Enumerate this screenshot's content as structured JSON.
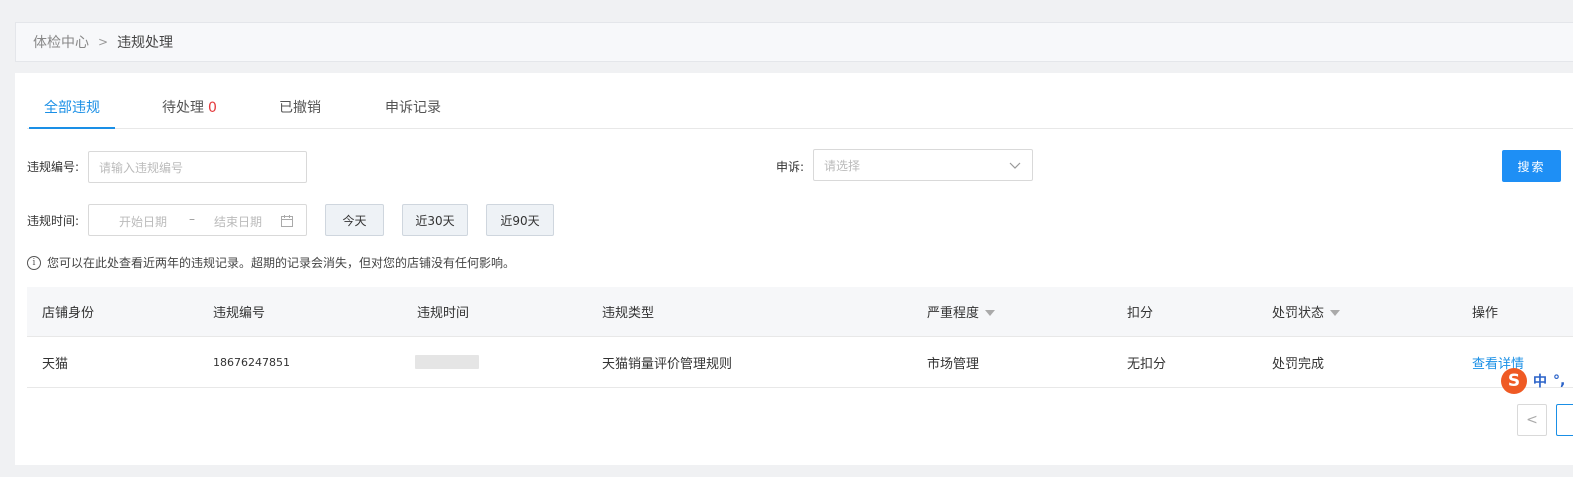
{
  "breadcrumb": {
    "root": "体检中心",
    "separator": ">",
    "current": "违规处理"
  },
  "tabs": [
    {
      "label": "全部违规",
      "active": true
    },
    {
      "label": "待处理",
      "count": "0"
    },
    {
      "label": "已撤销"
    },
    {
      "label": "申诉记录"
    }
  ],
  "filters": {
    "violation_no_label": "违规编号:",
    "violation_no_placeholder": "请输入违规编号",
    "appeal_label": "申诉:",
    "appeal_placeholder": "请选择",
    "search_button": "搜索",
    "time_label": "违规时间:",
    "start_placeholder": "开始日期",
    "range_dash": "–",
    "end_placeholder": "结束日期",
    "quick_today": "今天",
    "quick_30": "近30天",
    "quick_90": "近90天"
  },
  "notice": "您可以在此处查看近两年的违规记录。超期的记录会消失，但对您的店铺没有任何影响。",
  "table": {
    "headers": [
      "店铺身份",
      "违规编号",
      "违规时间",
      "违规类型",
      "严重程度",
      "扣分",
      "处罚状态",
      "操作"
    ],
    "rows": [
      {
        "shop_identity": "天猫",
        "violation_no": "18676247851",
        "violation_time": "",
        "violation_type": "天猫销量评价管理规则",
        "severity": "市场管理",
        "deduction": "无扣分",
        "status": "处罚完成",
        "action": "查看详情"
      }
    ]
  },
  "ime": {
    "logo": "S",
    "mode": "中",
    "punct": "°,"
  },
  "pager": {
    "prev": "<"
  },
  "colors": {
    "primary": "#1e8ff5",
    "accent_red": "#e4393c",
    "ime_orange": "#ef5a24"
  }
}
